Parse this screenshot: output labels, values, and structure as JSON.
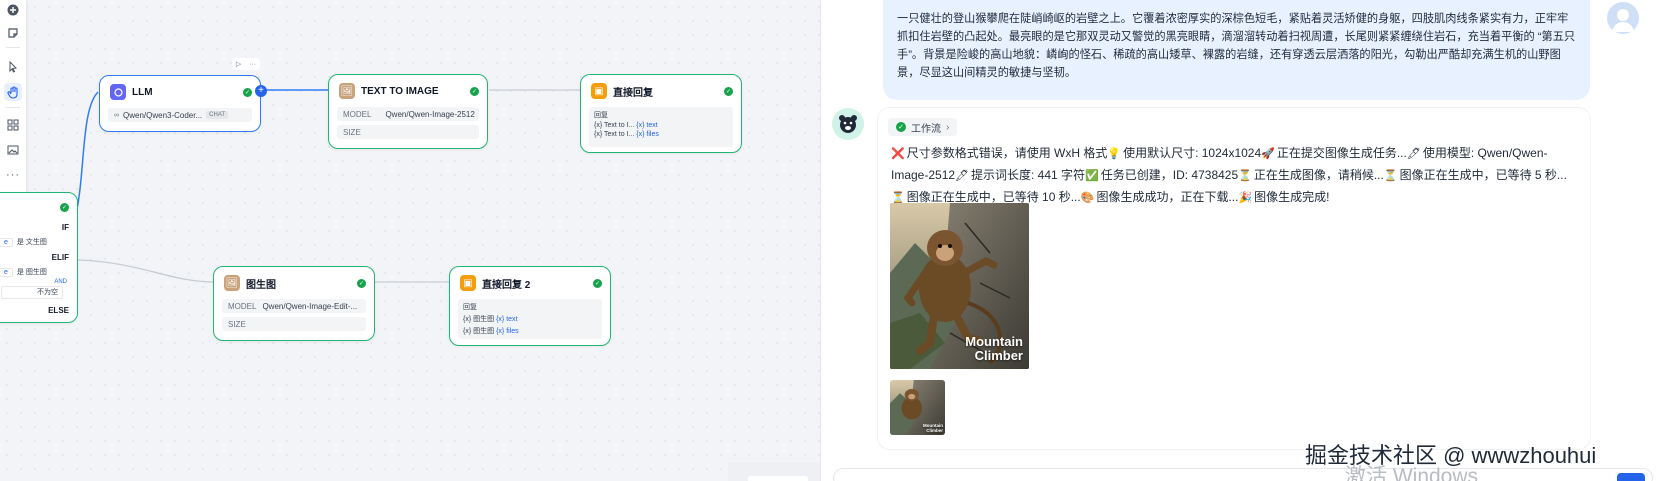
{
  "canvas": {
    "nodes": {
      "llm": {
        "title": "LLM",
        "model": "Qwen/Qwen3-Coder...",
        "badge": "CHAT"
      },
      "text_to_image": {
        "title": "TEXT TO IMAGE",
        "model_label": "MODEL",
        "model_value": "Qwen/Qwen-Image-2512",
        "size_label": "SIZE"
      },
      "reply1": {
        "title": "直接回复",
        "section": "回复",
        "vars": [
          {
            "src": "{x} Text to I...",
            "name": "{x} text"
          },
          {
            "src": "{x} Text to I...",
            "name": "{x} files"
          }
        ]
      },
      "condition": {
        "if": "IF",
        "elif": "ELIF",
        "else": "ELSE",
        "and": "AND",
        "row1_left": "e",
        "row1_right": "是 文生图",
        "row2_left": "e",
        "row2_right": "是 图生图",
        "row3_right": "不为空"
      },
      "img2img": {
        "title": "图生图",
        "model_label": "MODEL",
        "model_value": "Qwen/Qwen-Image-Edit-...",
        "size_label": "SIZE"
      },
      "reply2": {
        "title": "直接回复 2",
        "section": "回复",
        "vars": [
          {
            "src": "{x} 图生图",
            "name": "{x} text"
          },
          {
            "src": "{x} 图生图",
            "name": "{x} files"
          }
        ]
      }
    },
    "toolbar": [
      "add-icon",
      "note-icon",
      "pointer-icon",
      "hand-icon",
      "layout-icon",
      "image-icon",
      "more-icon"
    ],
    "node_controls": {
      "run": "▷",
      "more": "···"
    }
  },
  "chat": {
    "user_message": "一只健壮的登山猴攀爬在陡峭崎岖的岩壁之上。它覆着浓密厚实的深棕色短毛，紧贴着灵活矫健的身躯，四肢肌肉线条紧实有力，正牢牢抓扣住岩壁的凸起处。最亮眼的是它那双灵动又警觉的黑亮眼睛，滴溜溜转动着扫视周遭，长尾则紧紧缠绕住岩石，充当着平衡的 “第五只手”。背景是险峻的高山地貌：嶙峋的怪石、稀疏的高山矮草、裸露的岩缝，还有穿透云层洒落的阳光，勾勒出严酷却充满生机的山野图景，尽显这山间精灵的敏捷与坚韧。",
    "workflow_label": "工作流",
    "bot_segments": [
      {
        "emoji": "❌",
        "text": "尺寸参数格式错误，请使用 WxH 格式"
      },
      {
        "emoji": "💡",
        "text": "使用默认尺寸: 1024x1024"
      },
      {
        "emoji": "🚀",
        "text": "正在提交图像生成任务..."
      },
      {
        "emoji": "🖊",
        "text": "使用模型: Qwen/Qwen-Image-2512"
      },
      {
        "emoji": "🖊",
        "text": "提示词长度: 441 字符"
      },
      {
        "emoji": "✅",
        "text": "任务已创建，ID: 4738425"
      },
      {
        "emoji": "⏳",
        "text": "正在生成图像，请稍候..."
      },
      {
        "emoji": "⏳",
        "text": "图像正在生成中，已等待 5 秒..."
      },
      {
        "emoji": "⏳",
        "text": "图像正在生成中，已等待 10 秒..."
      },
      {
        "emoji": "🎨",
        "text": "图像生成成功，正在下载..."
      },
      {
        "emoji": "🎉",
        "text": "图像生成完成!"
      }
    ],
    "image_caption_line1": "Mountain",
    "image_caption_line2": "Climber"
  },
  "overlay": {
    "watermark": "掘金技术社区 @ wwwzhouhui",
    "windows_activation": "激活 Windows"
  },
  "colors": {
    "accent": "#2563eb",
    "node_border": "#22b573",
    "user_bubble": "#e8f1ff"
  }
}
